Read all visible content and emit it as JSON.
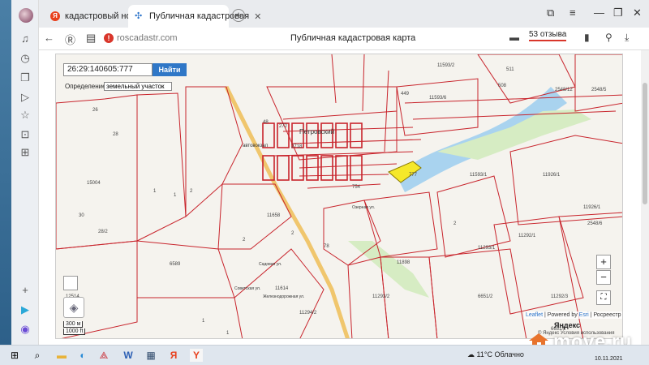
{
  "browser": {
    "tabs": [
      {
        "label": "кадастровый номер 26:29",
        "favicon": "yandex-favicon"
      },
      {
        "label": "Публичная кадастровая",
        "favicon": "map-favicon"
      }
    ],
    "url": "roscadastr.com",
    "page_title": "Публичная кадастровая карта",
    "reviews": "53 отзыва"
  },
  "map": {
    "search_value": "26:29:140605:777",
    "search_button": "Найти",
    "define_label": "Определение",
    "define_select": "земельный участок",
    "zoom_in": "+",
    "zoom_out": "−",
    "scale_300": "300 м",
    "scale_1000": "1000 ft",
    "attribution_leaflet": "Leaflet",
    "attribution_powered": "| Powered by",
    "attribution_esri": "Esri",
    "attribution_rosreestr": "| Росреестр",
    "yandex": "Яндекс",
    "terms": "© Яндекс  Условия использования",
    "parcel_labels": [
      "26",
      "28",
      "15004",
      "30",
      "28/2",
      "1",
      "2",
      "1",
      "11593/2",
      "511",
      "508",
      "449",
      "11593/6",
      "2548/12",
      "2548/5",
      "48",
      "272",
      "2718",
      "11593/1",
      "11926/1",
      "11926/1",
      "777",
      "754",
      "2",
      "11292/1",
      "2548/6",
      "11293/1",
      "11658",
      "2",
      "1",
      "6589",
      "2",
      "11898",
      "11293/2",
      "6651/2",
      "11292/3",
      "6651/5",
      "11294/2",
      "263",
      "12514",
      "11614",
      "78",
      "1"
    ],
    "place_labels": [
      "Петровский",
      "автовокзал",
      "Садовая ул.",
      "Советская ул.",
      "Озерная ул.",
      "Железнодорожная ул."
    ]
  },
  "taskbar": {
    "weather": "11°C  Облачно",
    "language": "РУС",
    "date": "10.11.2021"
  },
  "watermark": "move.ru",
  "colors": {
    "parcel": "#c8242c",
    "highlight": "#f5e82a",
    "water": "#a9d3ef",
    "road": "#f0c66d"
  }
}
